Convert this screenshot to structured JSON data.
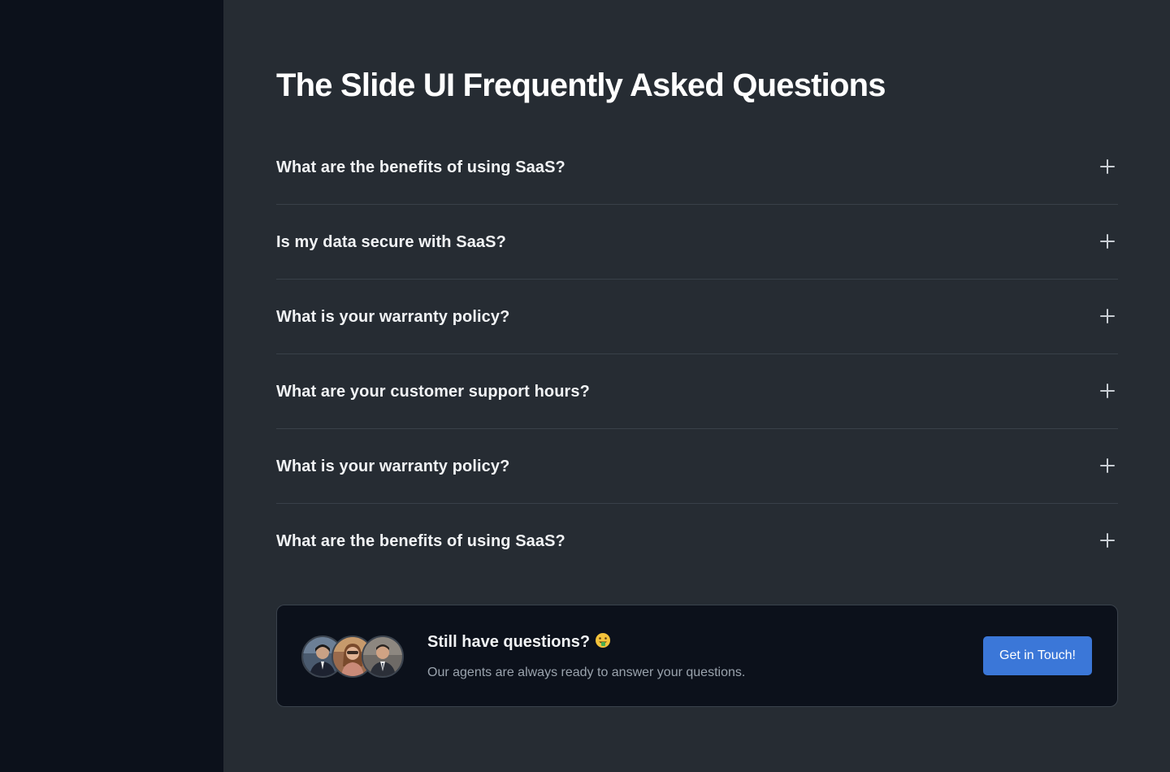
{
  "page": {
    "title": "The Slide UI Frequently Asked Questions"
  },
  "faq": {
    "items": [
      {
        "question": "What are the benefits of using SaaS?",
        "icon": "plus-icon"
      },
      {
        "question": "Is my data secure with SaaS?",
        "icon": "plus-icon"
      },
      {
        "question": "What is your warranty policy?",
        "icon": "plus-icon"
      },
      {
        "question": "What are your customer support hours?",
        "icon": "plus-icon"
      },
      {
        "question": "What is your warranty policy?",
        "icon": "plus-icon"
      },
      {
        "question": "What are the benefits of using SaaS?",
        "icon": "plus-icon"
      }
    ]
  },
  "cta": {
    "title": "Still have questions?",
    "emoji": "money-mouth-face-icon",
    "subtitle": "Our agents are always ready to answer your questions.",
    "button_label": "Get in Touch!",
    "avatars": [
      "agent-avatar-1",
      "agent-avatar-2",
      "agent-avatar-3"
    ]
  },
  "colors": {
    "sidebar_bg": "#0c111b",
    "main_bg": "#262c33",
    "card_bg": "#0c111b",
    "accent": "#3b77d8",
    "text_primary": "#f1f3f5",
    "text_secondary": "#9aa3ad",
    "divider": "#394049"
  }
}
